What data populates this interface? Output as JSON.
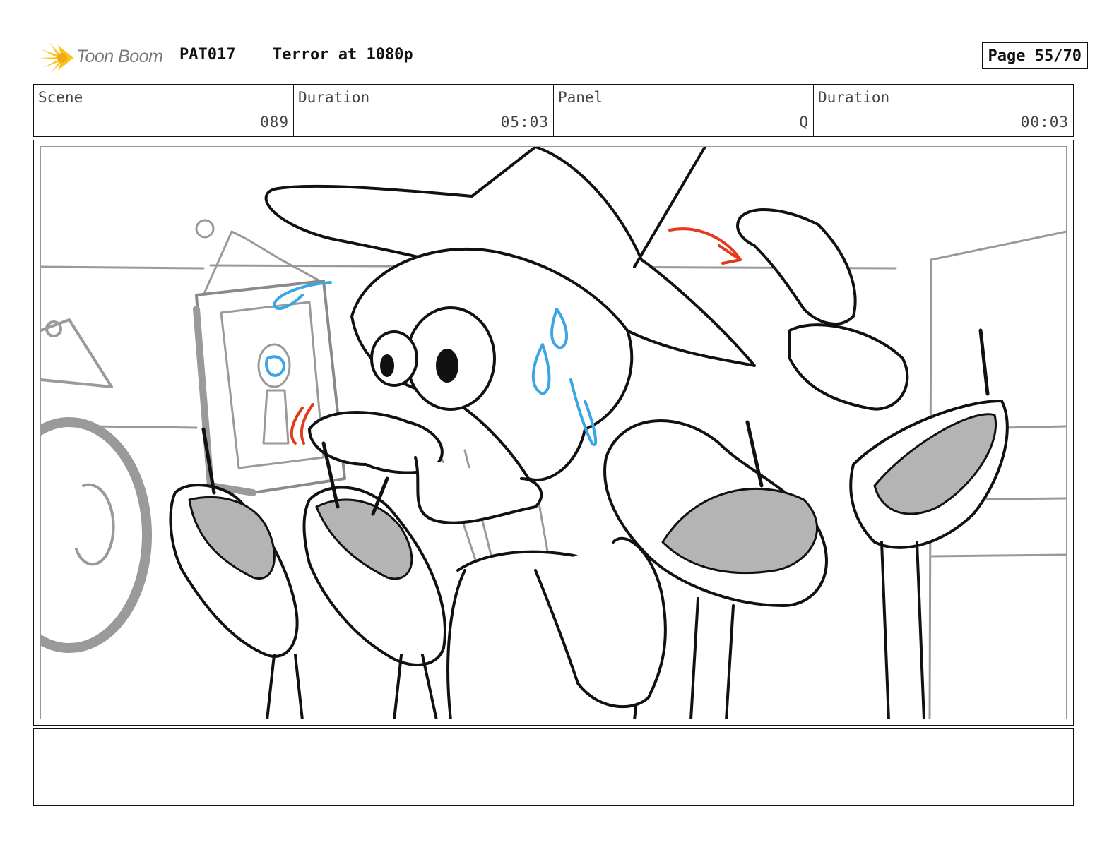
{
  "header": {
    "logo_text": "Toon Boom",
    "project_code": "PAT017",
    "episode_title": "Terror at 1080p",
    "page_indicator": "Page 55/70"
  },
  "info": {
    "scene_label": "Scene",
    "scene_value": "089",
    "scene_duration_label": "Duration",
    "scene_duration_value": "05:03",
    "panel_label": "Panel",
    "panel_value": "Q",
    "panel_duration_label": "Duration",
    "panel_duration_value": "00:03"
  },
  "notes": {
    "text": ""
  },
  "colors": {
    "ink": "#111111",
    "grey_fill": "#b4b4b4",
    "background_lines": "#9a9a9a",
    "sweat_blue": "#3aa6e6",
    "action_red": "#e23a1c",
    "logo_yellow": "#f7c51e"
  },
  "icons": {
    "logo": "toon-boom-starburst-icon"
  }
}
